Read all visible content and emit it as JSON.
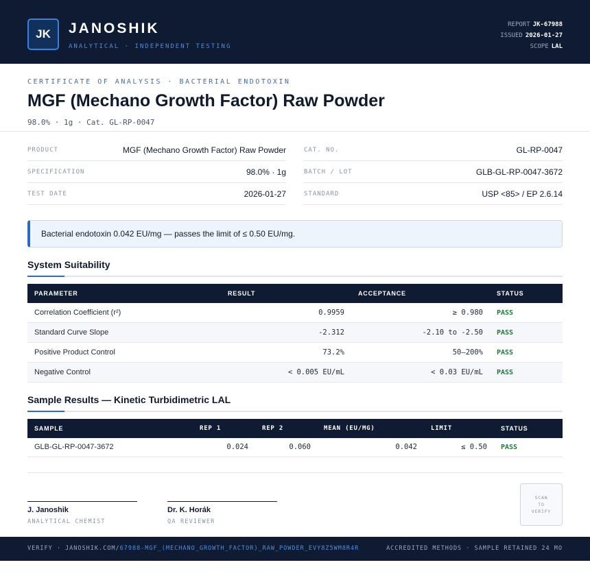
{
  "header": {
    "logo_initials": "JK",
    "brand": "JANOSHIK",
    "tagline": "ANALYTICAL · INDEPENDENT TESTING",
    "report_label": "REPORT",
    "report_value": "JK-67988",
    "issued_label": "ISSUED",
    "issued_value": "2026-01-27",
    "scope_label": "SCOPE",
    "scope_value": "LAL"
  },
  "title_block": {
    "eyebrow": "CERTIFICATE OF ANALYSIS · BACTERIAL ENDOTOXIN",
    "title": "MGF (Mechano Growth Factor) Raw Powder",
    "subtitle": "98.0% · 1g  ·  Cat. GL-RP-0047"
  },
  "info": {
    "product_label": "PRODUCT",
    "product_value": "MGF (Mechano Growth Factor) Raw Powder",
    "spec_label": "SPECIFICATION",
    "spec_value": "98.0% · 1g",
    "date_label": "TEST DATE",
    "date_value": "2026-01-27",
    "cat_label": "CAT. NO.",
    "cat_value": "GL-RP-0047",
    "batch_label": "BATCH / LOT",
    "batch_value": "GLB-GL-RP-0047-3672",
    "standard_label": "STANDARD",
    "standard_value": "USP <85> / EP 2.6.14"
  },
  "banner": {
    "text": "Bacterial endotoxin 0.042 EU/mg — passes the limit of ≤ 0.50 EU/mg."
  },
  "system_suitability": {
    "title": "System Suitability",
    "headers": [
      "PARAMETER",
      "RESULT",
      "ACCEPTANCE",
      "STATUS"
    ],
    "rows": [
      {
        "parameter": "Correlation Coefficient (r²)",
        "result": "0.9959",
        "acceptance": "≥ 0.980",
        "status": "PASS"
      },
      {
        "parameter": "Standard Curve Slope",
        "result": "-2.312",
        "acceptance": "-2.10 to -2.50",
        "status": "PASS"
      },
      {
        "parameter": "Positive Product Control",
        "result": "73.2%",
        "acceptance": "50–200%",
        "status": "PASS"
      },
      {
        "parameter": "Negative Control",
        "result": "< 0.005 EU/mL",
        "acceptance": "< 0.03 EU/mL",
        "status": "PASS"
      }
    ]
  },
  "sample_results": {
    "title": "Sample Results — Kinetic Turbidimetric LAL",
    "headers": [
      "SAMPLE",
      "REP 1",
      "REP 2",
      "MEAN (EU/MG)",
      "LIMIT",
      "STATUS"
    ],
    "rows": [
      {
        "sample": "GLB-GL-RP-0047-3672",
        "rep1": "0.024",
        "rep2": "0.060",
        "mean": "0.042",
        "limit": "≤ 0.50",
        "status": "PASS"
      }
    ]
  },
  "signatures": [
    {
      "name": "J. Janoshik",
      "role": "ANALYTICAL CHEMIST"
    },
    {
      "name": "Dr. K. Horák",
      "role": "QA REVIEWER"
    }
  ],
  "qr": {
    "line1": "SCAN",
    "line2": "TO",
    "line3": "VERIFY"
  },
  "footer": {
    "verify_prefix": "VERIFY · JANOSHIK.COM/",
    "verify_link": "67988-MGF_(MECHANO_GROWTH_FACTOR)_RAW_POWDER_EVY8Z5WM8R4R",
    "right_text": "ACCREDITED METHODS · SAMPLE RETAINED 24 MO"
  }
}
